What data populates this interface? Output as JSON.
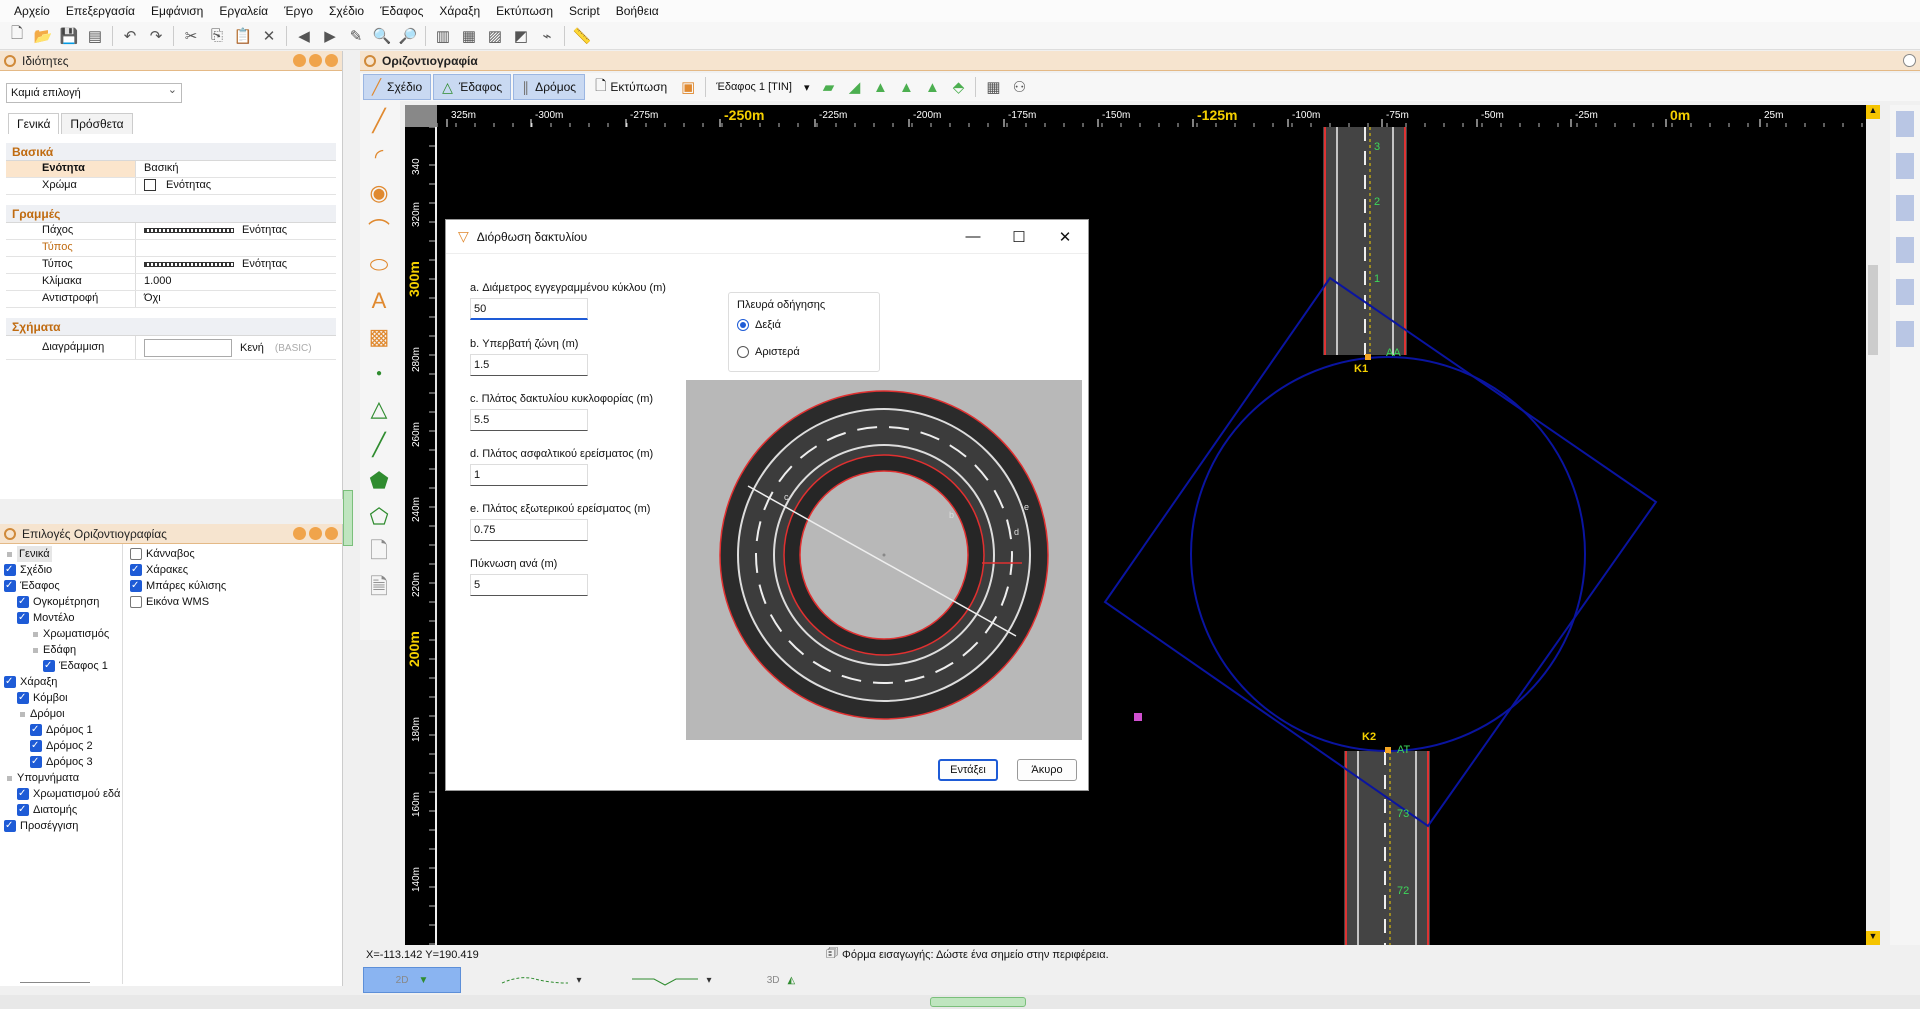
{
  "menu": [
    "Αρχείο",
    "Επεξεργασία",
    "Εμφάνιση",
    "Εργαλεία",
    "Έργο",
    "Σχέδιο",
    "Έδαφος",
    "Χάραξη",
    "Εκτύπωση",
    "Script",
    "Βοήθεια"
  ],
  "properties_panel": {
    "title": "Ιδιότητες",
    "selection": "Καμιά επιλογή",
    "tabs": [
      "Γενικά",
      "Πρόσθετα"
    ],
    "sections": {
      "basic": "Βασικά",
      "lines": "Γραμμές",
      "shapes": "Σχήματα"
    },
    "rows": {
      "unit_key": "Ενότητα",
      "unit_val": "Βασική",
      "color_key": "Χρώμα",
      "color_val": "Ενότητας",
      "thickness_key": "Πάχος",
      "thickness_val": "Ενότητας",
      "types_sub": "Τύπος",
      "type_key": "Τύπος",
      "type_val": "Ενότητας",
      "scale_key": "Κλίμακα",
      "scale_val": "1.000",
      "reverse_key": "Αντιστροφή",
      "reverse_val": "Όχι",
      "hatch_key": "Διαγράμμιση",
      "hatch_val": "Κενή",
      "hatch_extra": "(BASIC)"
    }
  },
  "options_panel": {
    "title": "Επιλογές Οριζοντιογραφίας",
    "left_tree": [
      {
        "label": "Γενικά",
        "type": "dot",
        "indent": 0
      },
      {
        "label": "Σχέδιο",
        "type": "check",
        "indent": 0
      },
      {
        "label": "Έδαφος",
        "type": "check",
        "indent": 0
      },
      {
        "label": "Ογκομέτρηση",
        "type": "check",
        "indent": 1
      },
      {
        "label": "Μοντέλο",
        "type": "check",
        "indent": 1
      },
      {
        "label": "Χρωματισμός",
        "type": "dot",
        "indent": 2
      },
      {
        "label": "Εδάφη",
        "type": "dot",
        "indent": 2
      },
      {
        "label": "Έδαφος 1",
        "type": "check",
        "indent": 3
      },
      {
        "label": "Χάραξη",
        "type": "check",
        "indent": 0
      },
      {
        "label": "Κόμβοι",
        "type": "check",
        "indent": 1
      },
      {
        "label": "Δρόμοι",
        "type": "dot",
        "indent": 1
      },
      {
        "label": "Δρόμος 1",
        "type": "check",
        "indent": 2
      },
      {
        "label": "Δρόμος 2",
        "type": "check",
        "indent": 2
      },
      {
        "label": "Δρόμος 3",
        "type": "check",
        "indent": 2
      },
      {
        "label": "Υπομνήματα",
        "type": "dot",
        "indent": 0
      },
      {
        "label": "Χρωματισμού εδά",
        "type": "check",
        "indent": 1
      },
      {
        "label": "Διατομής",
        "type": "check",
        "indent": 1
      },
      {
        "label": "Προσέγγιση",
        "type": "check",
        "indent": 0
      }
    ],
    "right_tree": [
      {
        "label": "Κάνναβος",
        "checked": false
      },
      {
        "label": "Χάρακες",
        "checked": true
      },
      {
        "label": "Μπάρες κύλισης",
        "checked": true
      },
      {
        "label": "Εικόνα WMS",
        "checked": false
      }
    ]
  },
  "document": {
    "title": "Οριζοντιογραφία",
    "ribbon_tabs": [
      "Σχέδιο",
      "Έδαφος",
      "Δρόμος",
      "Εκτύπωση"
    ],
    "terrain_select": "Έδαφος 1 [TIN]"
  },
  "ruler": {
    "h_labels": [
      "325m",
      "-300m",
      "-275m",
      "-250m",
      "-225m",
      "-200m",
      "-175m",
      "-150m",
      "-125m",
      "-100m",
      "-75m",
      "-50m",
      "-25m",
      "0m",
      "25m"
    ],
    "v_labels": [
      "340",
      "320m",
      "300m",
      "280m",
      "260m",
      "240m",
      "220m",
      "200m",
      "180m",
      "160m",
      "140m"
    ]
  },
  "canvas": {
    "node_labels": [
      "K1",
      "K2"
    ],
    "station_labels": [
      "3",
      "2",
      "1",
      "AA",
      "AT",
      "73",
      "72"
    ]
  },
  "dialog": {
    "title": "Διόρθωση δακτυλίου",
    "fields": [
      {
        "label": "a. Διάμετρος εγγεγραμμένου κύκλου (m)",
        "value": "50"
      },
      {
        "label": "b. Υπερβατή ζώνη (m)",
        "value": "1.5"
      },
      {
        "label": "c. Πλάτος δακτυλίου κυκλοφορίας (m)",
        "value": "5.5"
      },
      {
        "label": "d. Πλάτος ασφαλτικού ερείσματος (m)",
        "value": "1"
      },
      {
        "label": "e. Πλάτος εξωτερικού ερείσματος (m)",
        "value": "0.75"
      },
      {
        "label": "Πύκνωση ανά (m)",
        "value": "5"
      }
    ],
    "side_group": "Πλευρά οδήγησης",
    "side_right": "Δεξιά",
    "side_left": "Αριστερά",
    "diagram_labels": [
      "b",
      "c",
      "d",
      "e"
    ],
    "ok": "Εντάξει",
    "cancel": "Άκυρο"
  },
  "status": {
    "coords": "X=-113.142  Y=190.419",
    "message": "Φόρμα εισαγωγής: Δώστε ένα σημείο στην περιφέρεια."
  },
  "view_tabs": [
    "2D",
    "",
    "",
    "3D"
  ]
}
